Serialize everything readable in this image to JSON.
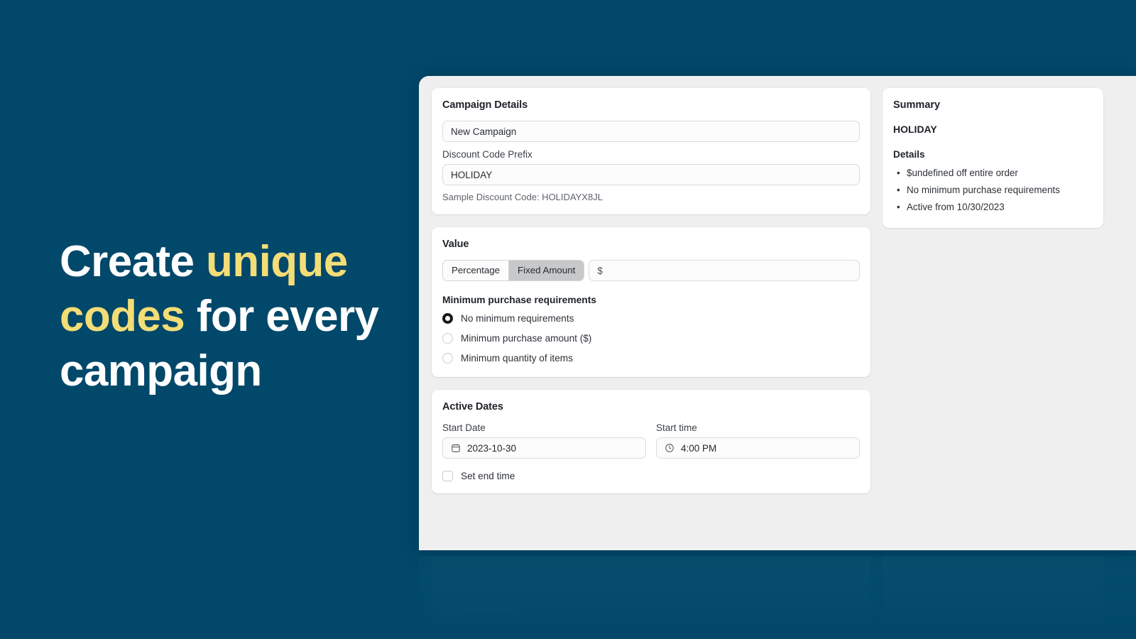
{
  "hero": {
    "line1_a": "Create ",
    "line1_b": "unique",
    "line2_a": "codes",
    "line2_b": " for every",
    "line3": "campaign"
  },
  "campaign_details": {
    "title": "Campaign Details",
    "name_value": "New Campaign",
    "name_placeholder": "New Campaign",
    "prefix_label": "Discount Code Prefix",
    "prefix_value": "HOLIDAY",
    "prefix_placeholder": "HOLIDAY",
    "sample_text": "Sample Discount Code: HOLIDAYX8JL"
  },
  "value": {
    "title": "Value",
    "segment_percentage": "Percentage",
    "segment_fixed": "Fixed Amount",
    "selected_segment": "Fixed Amount",
    "amount_prefix": "$",
    "amount_value": "",
    "minimum_heading": "Minimum purchase requirements",
    "radios": [
      {
        "label": "No minimum requirements",
        "selected": true
      },
      {
        "label": "Minimum purchase amount ($)",
        "selected": false
      },
      {
        "label": "Minimum quantity of items",
        "selected": false
      }
    ]
  },
  "active_dates": {
    "title": "Active Dates",
    "start_date_label": "Start Date",
    "start_date_value": "2023-10-30",
    "start_date_icon": "calendar-icon",
    "start_time_label": "Start time",
    "start_time_value": "4:00 PM",
    "start_time_icon": "clock-icon",
    "end_time_label": "Set end time",
    "end_time_checked": false
  },
  "summary": {
    "title": "Summary",
    "code": "HOLIDAY",
    "details_heading": "Details",
    "details": [
      "$undefined off entire order",
      "No minimum purchase requirements",
      "Active from 10/30/2023"
    ]
  },
  "reflection": {
    "label": "Set end time"
  },
  "colors": {
    "background": "#01486a",
    "accent_yellow": "#f3dd76",
    "panel_gray": "#efeff0",
    "card_white": "#ffffff",
    "active_segment": "#c7c8ca"
  }
}
